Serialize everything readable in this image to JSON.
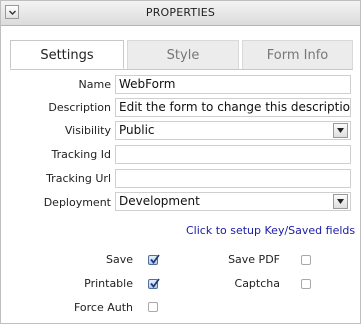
{
  "header": {
    "title": "PROPERTIES",
    "collapse_icon": "chevron-down-icon"
  },
  "tabs": [
    {
      "label": "Settings",
      "active": true
    },
    {
      "label": "Style",
      "active": false
    },
    {
      "label": "Form Info",
      "active": false
    }
  ],
  "form": {
    "name_label": "Name",
    "name_value": "WebForm",
    "description_label": "Description",
    "description_value": "Edit the form to change this description",
    "visibility_label": "Visibility",
    "visibility_value": "Public",
    "tracking_id_label": "Tracking Id",
    "tracking_id_value": "",
    "tracking_url_label": "Tracking Url",
    "tracking_url_value": "",
    "deployment_label": "Deployment",
    "deployment_value": "Development",
    "setup_link": "Click to setup Key/Saved fields"
  },
  "options": {
    "save_label": "Save",
    "save_checked": true,
    "save_pdf_label": "Save PDF",
    "save_pdf_checked": false,
    "printable_label": "Printable",
    "printable_checked": true,
    "captcha_label": "Captcha",
    "captcha_checked": false,
    "force_auth_label": "Force Auth",
    "force_auth_checked": false
  },
  "colors": {
    "link": "#1a1aa8",
    "check_accent": "#4e6f9f"
  }
}
